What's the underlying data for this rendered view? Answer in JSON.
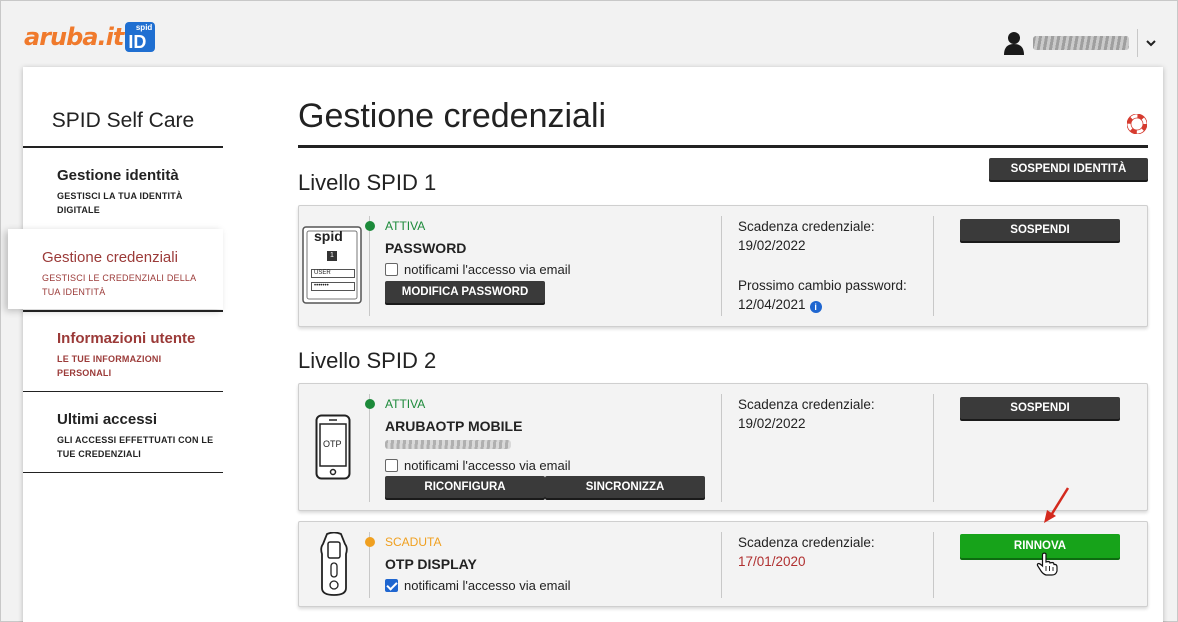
{
  "header": {
    "logo_text": "aruba.it",
    "logo_badge_top": "spid",
    "logo_badge_main": "ID",
    "user_icon": "user-icon",
    "dropdown_icon": "chevron-down-icon"
  },
  "sidebar": {
    "title": "SPID Self Care",
    "items": [
      {
        "label": "Gestione identità",
        "sub": "GESTISCI LA TUA IDENTITÀ DIGITALE"
      },
      {
        "label": "Gestione credenziali",
        "sub": "GESTISCI LE CREDENZIALI DELLA TUA IDENTITÀ"
      },
      {
        "label": "Informazioni utente",
        "sub": "LE TUE INFORMAZIONI PERSONALI"
      },
      {
        "label": "Ultimi accessi",
        "sub": "GLI ACCESSI EFFETTUATI CON LE TUE CREDENZIALI"
      }
    ]
  },
  "main": {
    "title": "Gestione credenziali",
    "suspend_identity": "SOSPENDI IDENTITÀ",
    "help_icon": "lifebuoy-icon",
    "level1": {
      "title": "Livello SPID 1",
      "cred": {
        "status": "ATTIVA",
        "name": "PASSWORD",
        "notify": "notificami l'accesso via email",
        "notify_checked": false,
        "action": "MODIFICA PASSWORD",
        "expiry_label": "Scadenza credenziale:",
        "expiry_value": "19/02/2022",
        "change_label": "Prossimo cambio password:",
        "change_value": "12/04/2021",
        "button": "SOSPENDI",
        "icon_text": "spid",
        "icon_badge": "1",
        "icon_field1": "USER",
        "icon_field2": "•••••••"
      }
    },
    "level2": {
      "title": "Livello SPID 2",
      "creds": [
        {
          "status": "ATTIVA",
          "name": "ARUBAOTP MOBILE",
          "notify": "notificami l'accesso via email",
          "notify_checked": false,
          "actions": [
            "RICONFIGURA",
            "SINCRONIZZA"
          ],
          "expiry_label": "Scadenza credenziale:",
          "expiry_value": "19/02/2022",
          "button": "SOSPENDI",
          "icon_text": "OTP"
        },
        {
          "status": "SCADUTA",
          "name": "OTP DISPLAY",
          "notify": "notificami l'accesso via email",
          "notify_checked": true,
          "expiry_label": "Scadenza credenziale:",
          "expiry_value": "17/01/2020",
          "button": "RINNOVA"
        }
      ]
    }
  },
  "colors": {
    "active": "#1c8a3a",
    "expired": "#f0a020",
    "brand_orange": "#f07a2c",
    "brand_blue": "#1f6fd1",
    "accent_red": "#9b3a38",
    "renew_green": "#17a31a"
  }
}
